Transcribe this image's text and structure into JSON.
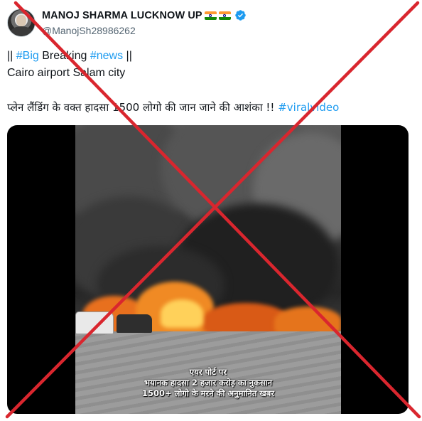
{
  "author": {
    "name": "MANOJ SHARMA LUCKNOW UP",
    "handle": "@ManojSh28986262",
    "flags": [
      "india-flag",
      "india-flag"
    ],
    "verified_icon": "verified-badge-icon"
  },
  "tweet": {
    "line1": {
      "pre": "|| ",
      "tag1": "#Big",
      "mid": " Breaking ",
      "tag2": "#news",
      "post": " ||"
    },
    "line2": "Cairo airport Salam city",
    "line3": {
      "text": "प्लेन लैंडिंग के वक्त हादसा 1500 लोगो की जान जाने की आशंका !! ",
      "tag": "#viralvideo"
    }
  },
  "media": {
    "caption_lines": [
      "एयर पोर्ट पर",
      "भयानक हादसा 2 हजार करोड़ का नुकसान",
      "1500+ लोगो के मरने की अनुमानित खबर"
    ]
  },
  "overlay": {
    "icon": "red-x-cross-icon",
    "color": "#d9262e"
  },
  "colors": {
    "link": "#1d9bf0",
    "verified": "#1d9bf0",
    "handle": "#536471"
  }
}
